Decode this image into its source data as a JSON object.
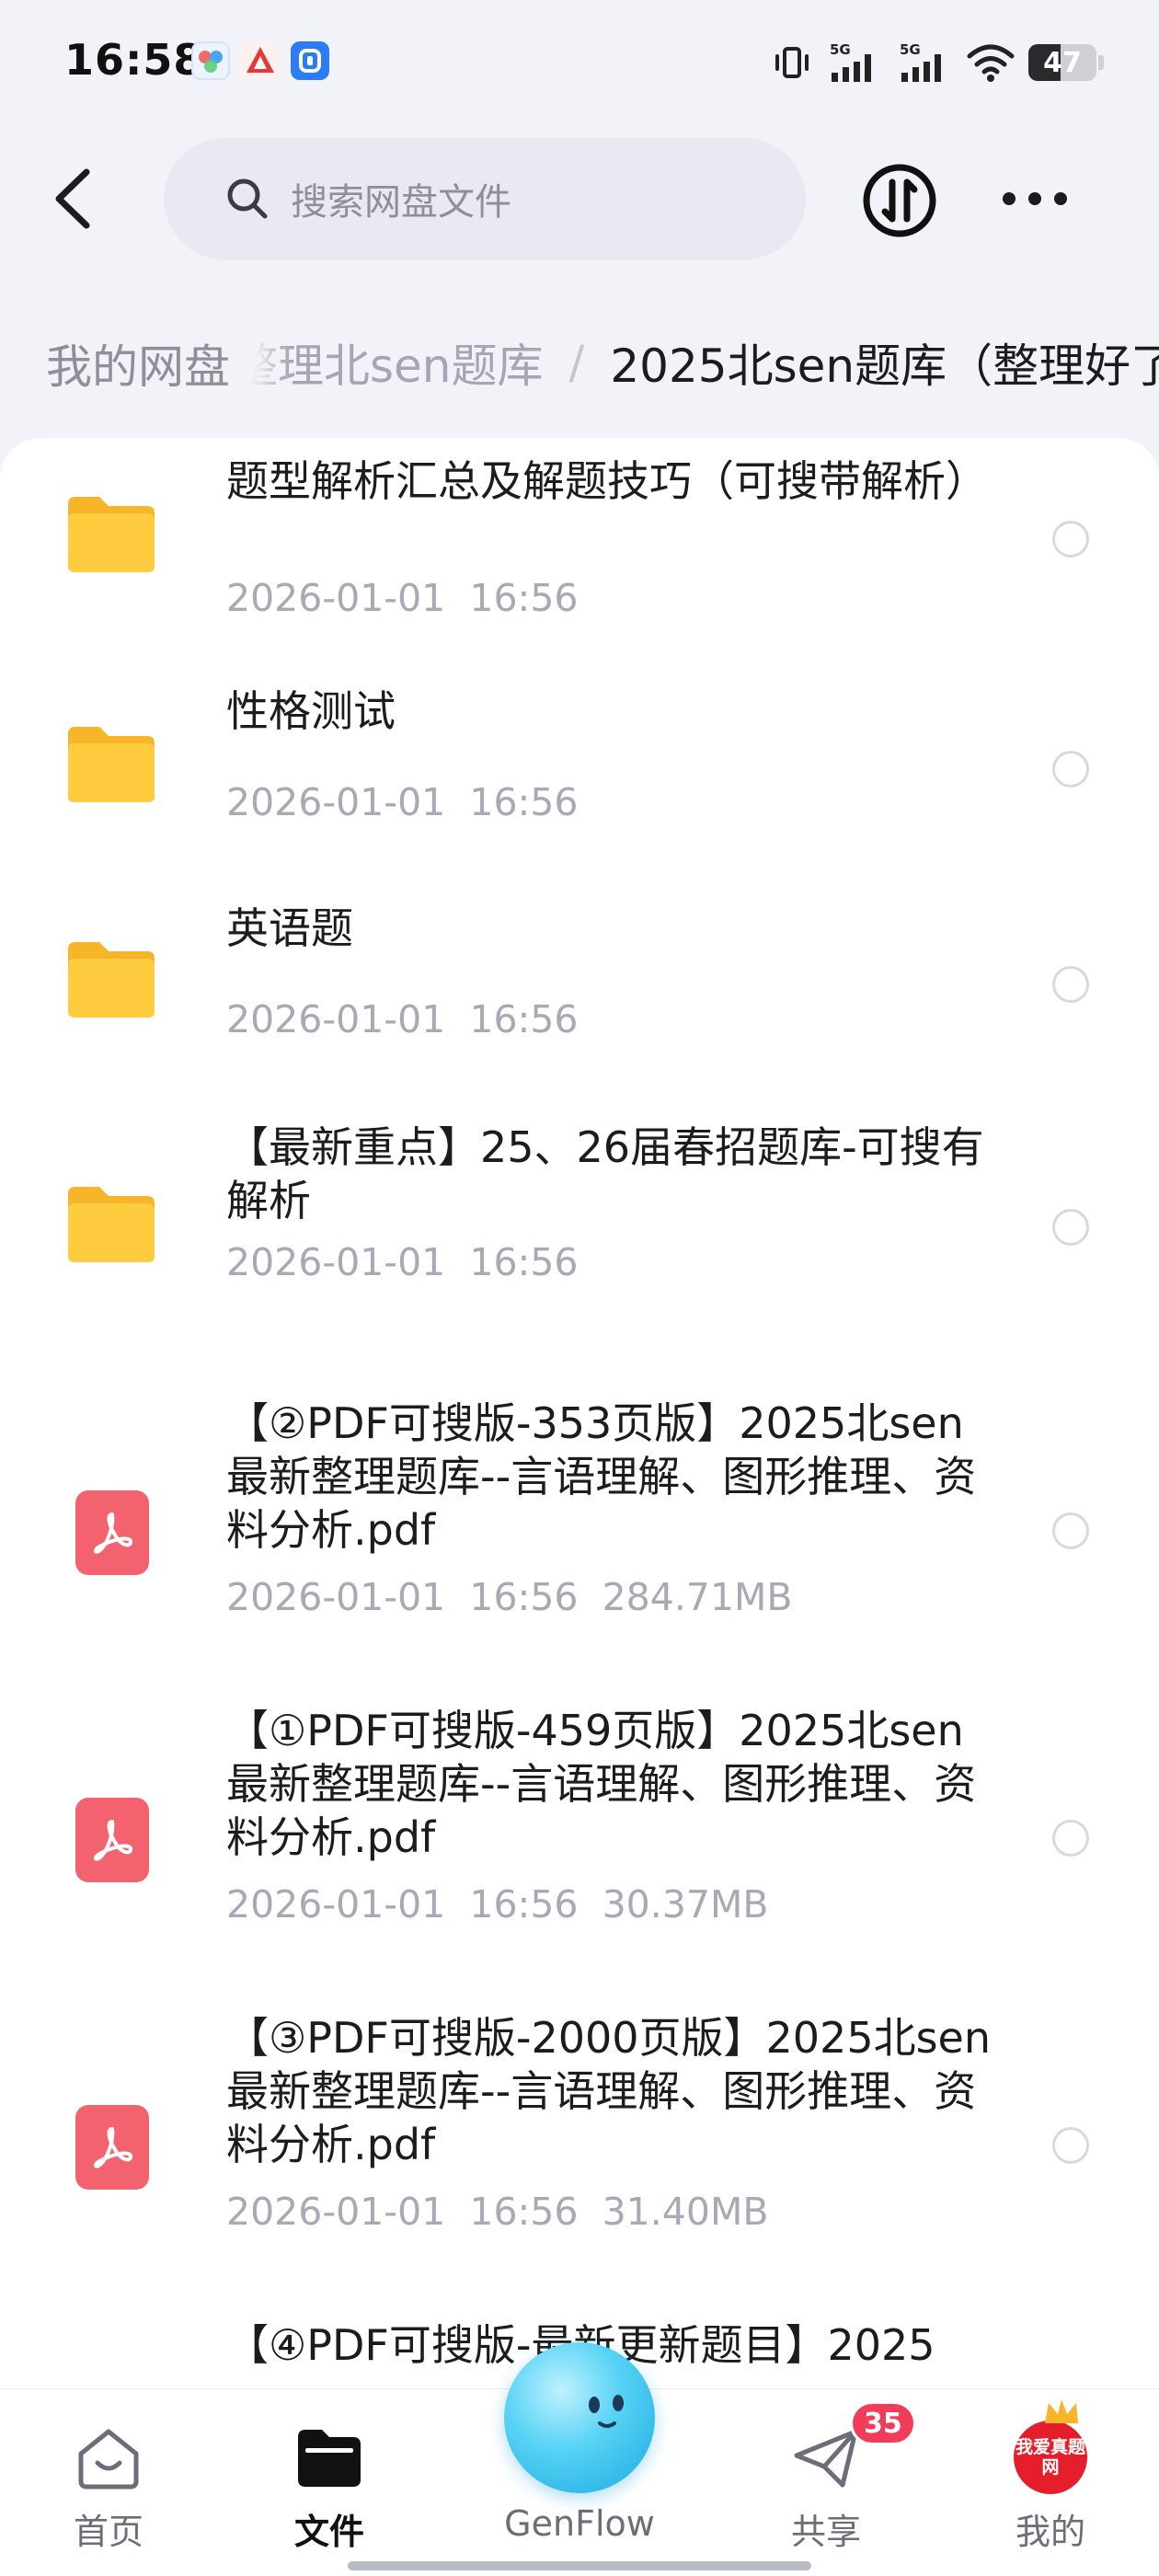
{
  "status_bar": {
    "time": "16:58",
    "signal_label": "5G",
    "battery_level": 47,
    "battery_text": "47"
  },
  "search": {
    "placeholder": "搜索网盘文件"
  },
  "breadcrumb": {
    "root": "我的网盘",
    "previous": "整理北sen题库",
    "separator": "/",
    "current": "2025北sen题库（整理好了"
  },
  "files": [
    {
      "type": "folder",
      "name": "题型解析汇总及解题技巧（可搜带解析）",
      "date": "2026-01-01",
      "time": "16:56",
      "size": ""
    },
    {
      "type": "folder",
      "name": "性格测试",
      "date": "2026-01-01",
      "time": "16:56",
      "size": ""
    },
    {
      "type": "folder",
      "name": "英语题",
      "date": "2026-01-01",
      "time": "16:56",
      "size": ""
    },
    {
      "type": "folder",
      "name": "【最新重点】25、26届春招题库-可搜有解析",
      "date": "2026-01-01",
      "time": "16:56",
      "size": ""
    },
    {
      "type": "pdf",
      "name": "【②PDF可搜版-353页版】2025北sen最新整理题库--言语理解、图形推理、资料分析.pdf",
      "date": "2026-01-01",
      "time": "16:56",
      "size": "284.71MB"
    },
    {
      "type": "pdf",
      "name": "【①PDF可搜版-459页版】2025北sen最新整理题库--言语理解、图形推理、资料分析.pdf",
      "date": "2026-01-01",
      "time": "16:56",
      "size": "30.37MB"
    },
    {
      "type": "pdf",
      "name": "【③PDF可搜版-2000页版】2025北sen最新整理题库--言语理解、图形推理、资料分析.pdf",
      "date": "2026-01-01",
      "time": "16:56",
      "size": "31.40MB"
    },
    {
      "type": "pdf",
      "name": "【④PDF可搜版-最新更新题目】2025",
      "date": "",
      "time": "",
      "size": ""
    }
  ],
  "bottom_nav": {
    "items": [
      {
        "label": "首页",
        "icon": "home-icon",
        "active": false
      },
      {
        "label": "文件",
        "icon": "folder-icon",
        "active": true
      },
      {
        "label": "GenFlow",
        "icon": "genflow-orb-icon",
        "active": false
      },
      {
        "label": "共享",
        "icon": "paper-plane-icon",
        "active": false
      },
      {
        "label": "我的",
        "icon": "avatar-icon",
        "active": false
      }
    ],
    "share_badge": "35",
    "avatar_text": "我爱真题网"
  },
  "colors": {
    "accent_folder": "#ffc93c",
    "pdf_red": "#f2636f",
    "badge_red": "#f23d5a",
    "meta_gray": "#a7a9b4"
  }
}
